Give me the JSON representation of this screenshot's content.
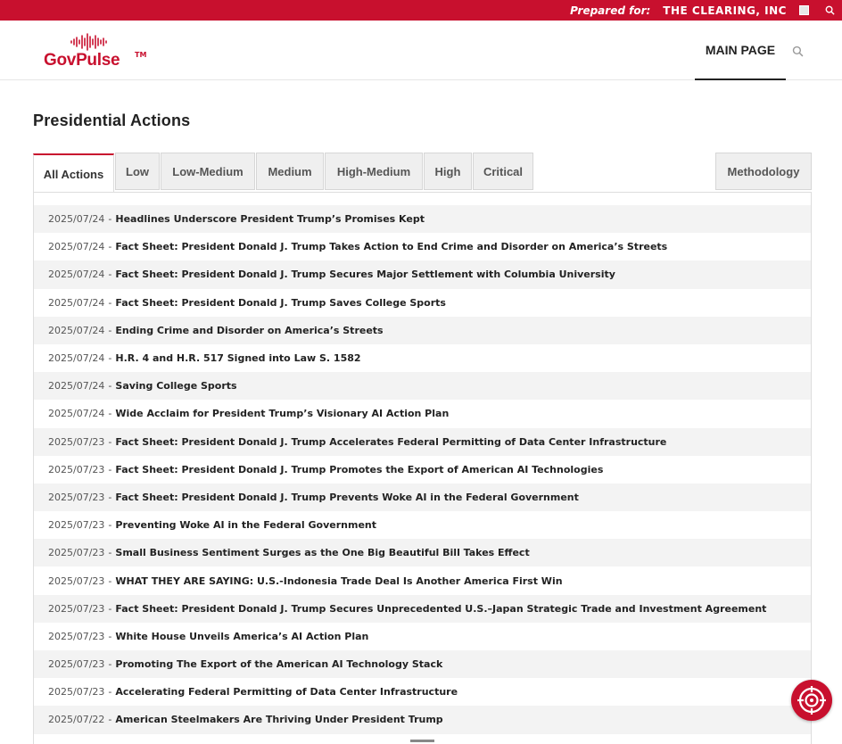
{
  "topbar": {
    "prepared_label": "Prepared for:",
    "client_name": "THE CLEARING, INC"
  },
  "header": {
    "logo_text_gov": "Gov",
    "logo_text_pulse": "Pulse",
    "logo_tm": "TM",
    "nav_main": "MAIN PAGE"
  },
  "page": {
    "title": "Presidential Actions"
  },
  "tabs": [
    {
      "label": "All Actions"
    },
    {
      "label": "Low"
    },
    {
      "label": "Low-Medium"
    },
    {
      "label": "Medium"
    },
    {
      "label": "High-Medium"
    },
    {
      "label": "High"
    },
    {
      "label": "Critical"
    },
    {
      "label": "Methodology"
    }
  ],
  "separator": "-",
  "actions": [
    {
      "date": "2025/07/24",
      "title": "Headlines Underscore President Trump’s Promises Kept"
    },
    {
      "date": "2025/07/24",
      "title": "Fact Sheet: President Donald J. Trump Takes Action to End Crime and Disorder on America’s Streets"
    },
    {
      "date": "2025/07/24",
      "title": "Fact Sheet: President Donald J. Trump Secures Major Settlement with Columbia University"
    },
    {
      "date": "2025/07/24",
      "title": "Fact Sheet: President Donald J. Trump Saves College Sports"
    },
    {
      "date": "2025/07/24",
      "title": "Ending Crime and Disorder on America’s Streets"
    },
    {
      "date": "2025/07/24",
      "title": "H.R. 4 and H.R. 517 Signed into Law S. 1582"
    },
    {
      "date": "2025/07/24",
      "title": "Saving College Sports"
    },
    {
      "date": "2025/07/24",
      "title": "Wide Acclaim for President Trump’s Visionary AI Action Plan"
    },
    {
      "date": "2025/07/23",
      "title": "Fact Sheet: President Donald J. Trump Accelerates Federal Permitting of Data Center Infrastructure"
    },
    {
      "date": "2025/07/23",
      "title": "Fact Sheet: President Donald J. Trump Promotes the Export of American AI Technologies"
    },
    {
      "date": "2025/07/23",
      "title": "Fact Sheet: President Donald J. Trump Prevents Woke AI in the Federal Government"
    },
    {
      "date": "2025/07/23",
      "title": "Preventing Woke AI in the Federal Government"
    },
    {
      "date": "2025/07/23",
      "title": "Small Business Sentiment Surges as the One Big Beautiful Bill Takes Effect"
    },
    {
      "date": "2025/07/23",
      "title": "WHAT THEY ARE SAYING: U.S.-Indonesia Trade Deal Is Another America First Win"
    },
    {
      "date": "2025/07/23",
      "title": "Fact Sheet: President Donald J. Trump Secures Unprecedented U.S.–Japan Strategic Trade and Investment Agreement"
    },
    {
      "date": "2025/07/23",
      "title": "White House Unveils America’s AI Action Plan"
    },
    {
      "date": "2025/07/23",
      "title": "Promoting The Export of the American AI Technology Stack"
    },
    {
      "date": "2025/07/23",
      "title": "Accelerating Federal Permitting of Data Center Infrastructure"
    },
    {
      "date": "2025/07/22",
      "title": "American Steelmakers Are Thriving Under President Trump"
    }
  ],
  "colors": {
    "brand": "#c8102e",
    "row_alt": "#f3f3f3",
    "tab_bg": "#efefef"
  },
  "icons": {
    "topbar_search": "search-icon",
    "nav_search": "search-icon",
    "fab": "target-icon"
  }
}
